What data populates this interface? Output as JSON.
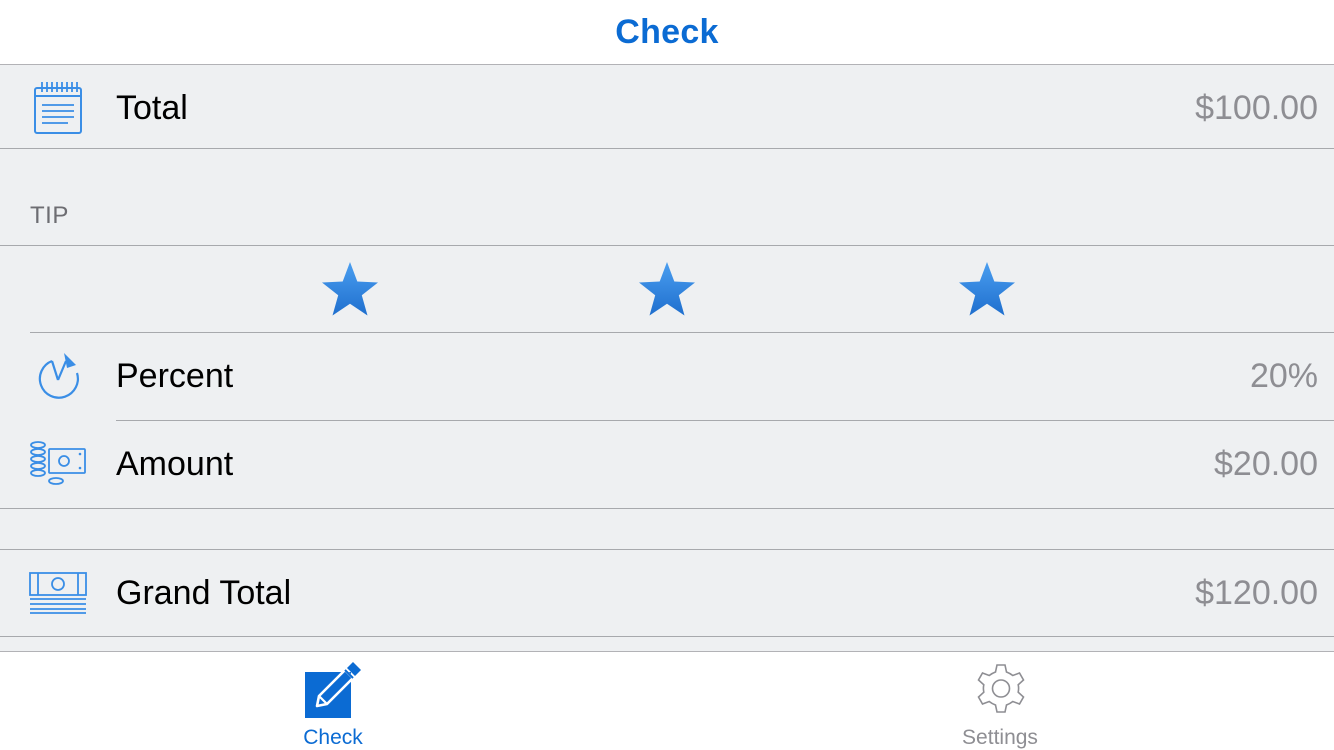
{
  "navbar": {
    "title": "Check"
  },
  "total_row": {
    "label": "Total",
    "value": "$100.00",
    "icon": "notepad-icon"
  },
  "tip_section": {
    "header": "TIP"
  },
  "stars": {
    "count": 3,
    "icon": "star-icon"
  },
  "percent_row": {
    "label": "Percent",
    "value": "20%",
    "icon": "pie-chart-icon"
  },
  "amount_row": {
    "label": "Amount",
    "value": "$20.00",
    "icon": "coins-cash-icon"
  },
  "grand_total_row": {
    "label": "Grand Total",
    "value": "$120.00",
    "icon": "money-bills-icon"
  },
  "tabbar": {
    "tabs": [
      {
        "label": "Check",
        "icon": "edit-pencil-icon",
        "selected": true
      },
      {
        "label": "Settings",
        "icon": "gear-icon",
        "selected": false
      }
    ]
  },
  "colors": {
    "accent": "#0b6bd3",
    "icon_blue": "#3a8ee6",
    "background": "#eef0f2",
    "value_gray": "#8e8e93"
  }
}
